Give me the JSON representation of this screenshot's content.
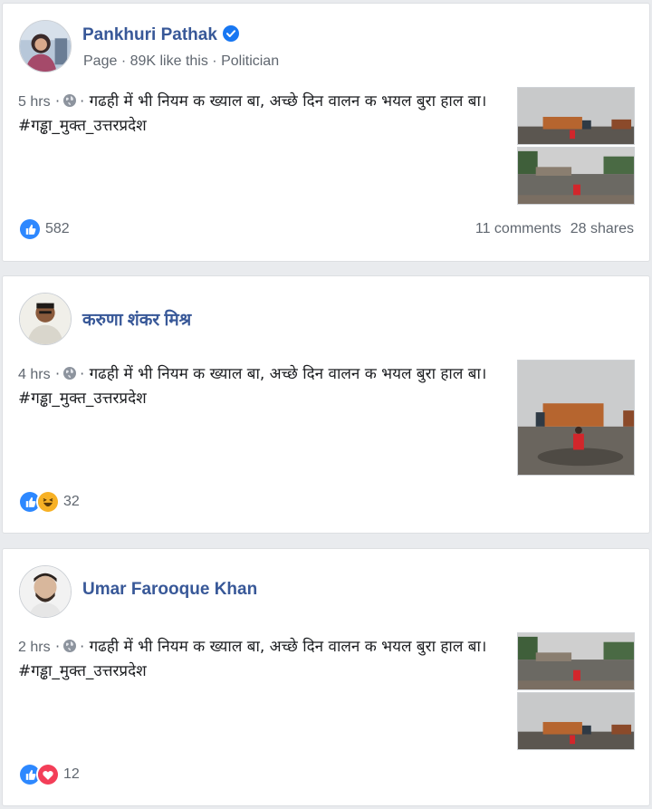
{
  "colors": {
    "link": "#385898",
    "meta": "#606770",
    "like_blue": "#2d88ff",
    "love_red": "#f33e58",
    "haha_yellow": "#f7b125"
  },
  "posts": [
    {
      "author": "Pankhuri Pathak",
      "verified": true,
      "subtitle": "Page · 89K like this · Politician",
      "time": "5 hrs",
      "audience_icon": "globe-icon",
      "text": "गढही में भी नियम क ख्याल बा, अच्छे दिन वालन क भयल बुरा हाल बा।",
      "hashtag": "#गड्ढा_मुक्त_उत्तरप्रदेश",
      "reactions": [
        "like-icon"
      ],
      "reaction_count": "582",
      "comments": "11 comments",
      "shares": "28 shares"
    },
    {
      "author": "करुणा शंकर मिश्र",
      "verified": false,
      "time": "4 hrs",
      "audience_icon": "globe-icon",
      "text": "गढही में भी नियम क ख्याल बा, अच्छे दिन वालन क भयल बुरा हाल बा।",
      "hashtag": "#गड्ढा_मुक्त_उत्तरप्रदेश",
      "reactions": [
        "like-icon",
        "haha-icon"
      ],
      "reaction_count": "32"
    },
    {
      "author": "Umar Farooque Khan",
      "verified": false,
      "time": "2 hrs",
      "audience_icon": "globe-icon",
      "text": "गढही में भी नियम क ख्याल बा, अच्छे दिन वालन क भयल बुरा हाल बा।",
      "hashtag": "#गड्ढा_मुक्त_उत्तरप्रदेश",
      "reactions": [
        "like-icon",
        "love-icon"
      ],
      "reaction_count": "12"
    }
  ]
}
